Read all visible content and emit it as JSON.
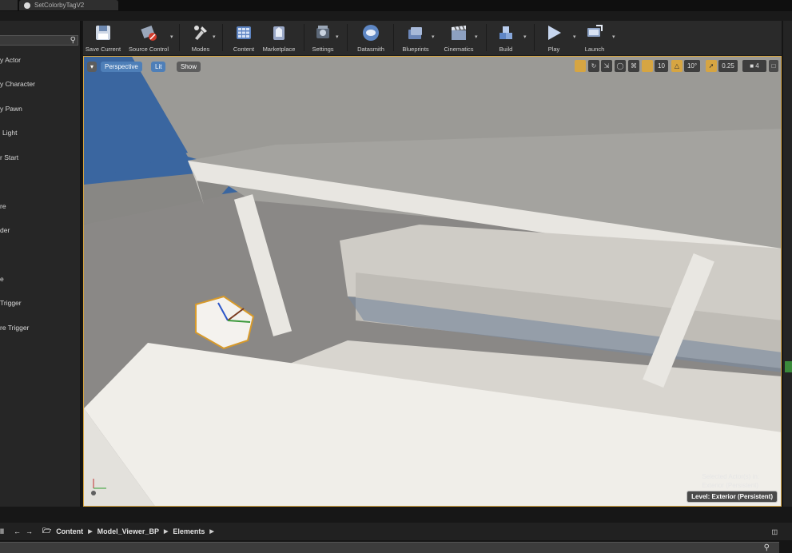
{
  "tab": {
    "title": "SetColorbyTagV2"
  },
  "place_items": [
    "y Actor",
    "y Character",
    "y Pawn",
    "Light",
    "r Start",
    "re",
    "der",
    "e",
    "Trigger",
    "re Trigger"
  ],
  "toolbar": {
    "save_current": "Save Current",
    "source_control": "Source Control",
    "modes": "Modes",
    "content": "Content",
    "marketplace": "Marketplace",
    "settings": "Settings",
    "datasmith": "Datasmith",
    "blueprints": "Blueprints",
    "cinematics": "Cinematics",
    "build": "Build",
    "play": "Play",
    "launch": "Launch"
  },
  "viewport": {
    "perspective": "Perspective",
    "lit": "Lit",
    "show": "Show",
    "grid_snap": "10",
    "rotation_snap": "10°",
    "scale_snap": "0.25",
    "camera_speed": "4",
    "selected_actor_line1": "Selected Actor(s) in:",
    "selected_actor_line2": "Exterior (Persistent)",
    "level_label": "Level:",
    "level_value": "Exterior (Persistent)"
  },
  "breadcrumb": {
    "cut": "ll",
    "items": [
      "Content",
      "Model_Viewer_BP",
      "Elements"
    ]
  },
  "colors": {
    "accent_orange": "#d6a542",
    "sky_blue": "#3a66a0",
    "button_blue": "#4e7fb8"
  }
}
